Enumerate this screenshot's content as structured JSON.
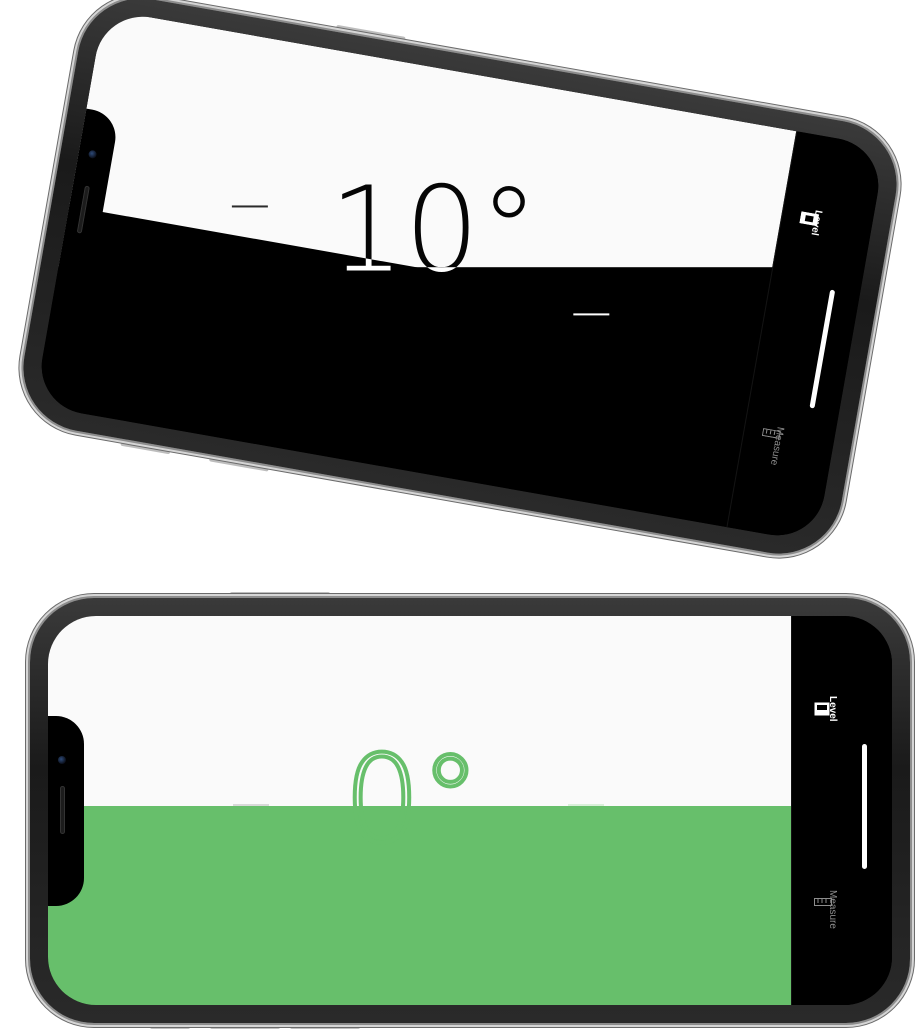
{
  "app": {
    "name": "Measure"
  },
  "tabs": [
    {
      "id": "level",
      "label": "Level"
    },
    {
      "id": "measure",
      "label": "Measure"
    }
  ],
  "screens": [
    {
      "state": "tilted",
      "angle_text": "10°",
      "colors": {
        "top": "#fafafa",
        "bottom": "#000000",
        "digits": "#ffffff",
        "active_tab": "level"
      }
    },
    {
      "state": "level",
      "angle_text": "0°",
      "colors": {
        "top": "#fafafa",
        "bottom": "#67bf6b",
        "digits": "#ffffff",
        "active_tab": "level"
      }
    }
  ]
}
